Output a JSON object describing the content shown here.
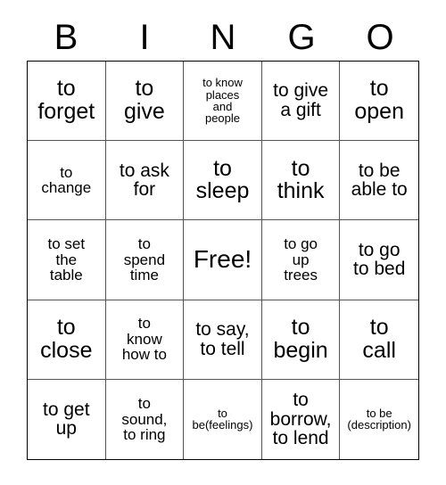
{
  "card": {
    "title": "BINGO",
    "free_space_label": "Free!"
  },
  "header": {
    "letters": [
      "B",
      "I",
      "N",
      "G",
      "O"
    ]
  },
  "grid": {
    "columns": 5,
    "rows": 5,
    "border_color": "#000000",
    "gridline_color": "#555555",
    "background_color": "#ffffff",
    "text_color": "#000000"
  },
  "cells": [
    {
      "text": "to\nforget",
      "size": "lg",
      "row": 1,
      "col": 1,
      "column_letter": "B"
    },
    {
      "text": "to\ngive",
      "size": "lg",
      "row": 1,
      "col": 2,
      "column_letter": "I"
    },
    {
      "text": "to know\nplaces\nand\npeople",
      "size": "xs",
      "row": 1,
      "col": 3,
      "column_letter": "N"
    },
    {
      "text": "to give\na gift",
      "size": "md",
      "row": 1,
      "col": 4,
      "column_letter": "G"
    },
    {
      "text": "to\nopen",
      "size": "lg",
      "row": 1,
      "col": 5,
      "column_letter": "O"
    },
    {
      "text": "to\nchange",
      "size": "sm",
      "row": 2,
      "col": 1,
      "column_letter": "B"
    },
    {
      "text": "to ask\nfor",
      "size": "md",
      "row": 2,
      "col": 2,
      "column_letter": "I"
    },
    {
      "text": "to\nsleep",
      "size": "lg",
      "row": 2,
      "col": 3,
      "column_letter": "N"
    },
    {
      "text": "to\nthink",
      "size": "lg",
      "row": 2,
      "col": 4,
      "column_letter": "G"
    },
    {
      "text": "to be\nable to",
      "size": "md",
      "row": 2,
      "col": 5,
      "column_letter": "O"
    },
    {
      "text": "to set\nthe\ntable",
      "size": "sm",
      "row": 3,
      "col": 1,
      "column_letter": "B"
    },
    {
      "text": "to\nspend\ntime",
      "size": "sm",
      "row": 3,
      "col": 2,
      "column_letter": "I"
    },
    {
      "text": "Free!",
      "size": "free",
      "row": 3,
      "col": 3,
      "column_letter": "N",
      "is_free_space": true
    },
    {
      "text": "to go\nup\ntrees",
      "size": "sm",
      "row": 3,
      "col": 4,
      "column_letter": "G"
    },
    {
      "text": "to go\nto bed",
      "size": "md",
      "row": 3,
      "col": 5,
      "column_letter": "O"
    },
    {
      "text": "to\nclose",
      "size": "lg",
      "row": 4,
      "col": 1,
      "column_letter": "B"
    },
    {
      "text": "to\nknow\nhow to",
      "size": "sm",
      "row": 4,
      "col": 2,
      "column_letter": "I"
    },
    {
      "text": "to say,\nto tell",
      "size": "md",
      "row": 4,
      "col": 3,
      "column_letter": "N"
    },
    {
      "text": "to\nbegin",
      "size": "lg",
      "row": 4,
      "col": 4,
      "column_letter": "G"
    },
    {
      "text": "to\ncall",
      "size": "lg",
      "row": 4,
      "col": 5,
      "column_letter": "O"
    },
    {
      "text": "to get\nup",
      "size": "md",
      "row": 5,
      "col": 1,
      "column_letter": "B"
    },
    {
      "text": "to\nsound,\nto ring",
      "size": "sm",
      "row": 5,
      "col": 2,
      "column_letter": "I"
    },
    {
      "text": "to\nbe(feelings)",
      "size": "xs",
      "row": 5,
      "col": 3,
      "column_letter": "N"
    },
    {
      "text": "to\nborrow,\nto lend",
      "size": "md",
      "row": 5,
      "col": 4,
      "column_letter": "G"
    },
    {
      "text": "to be\n(description)",
      "size": "xs",
      "row": 5,
      "col": 5,
      "column_letter": "O"
    }
  ]
}
